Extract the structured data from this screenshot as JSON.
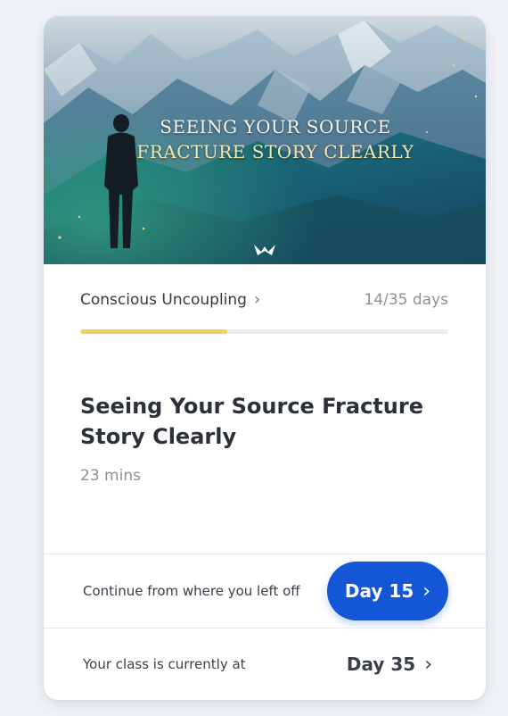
{
  "hero": {
    "title_line1": "SEEING YOUR SOURCE",
    "title_line2": "FRACTURE STORY CLEARLY",
    "logo_icon": "mindvalley-logo-icon",
    "colors": {
      "sky": "#c9d6de",
      "mountain": "#2f6c8c",
      "glow": "#2aa383"
    }
  },
  "program": {
    "name": "Conscious Uncoupling",
    "chevron": "›",
    "days": "14/35 days",
    "progress_fraction": 0.4
  },
  "lesson": {
    "title": "Seeing Your Source Fracture Story Clearly",
    "duration": "23 mins"
  },
  "continue": {
    "label": "Continue from where you left off",
    "button_label": "Day 15",
    "chevron": "›",
    "accent": "#1356d6"
  },
  "current": {
    "label": "Your class is currently at",
    "day_label": "Day 35",
    "chevron": "›"
  }
}
